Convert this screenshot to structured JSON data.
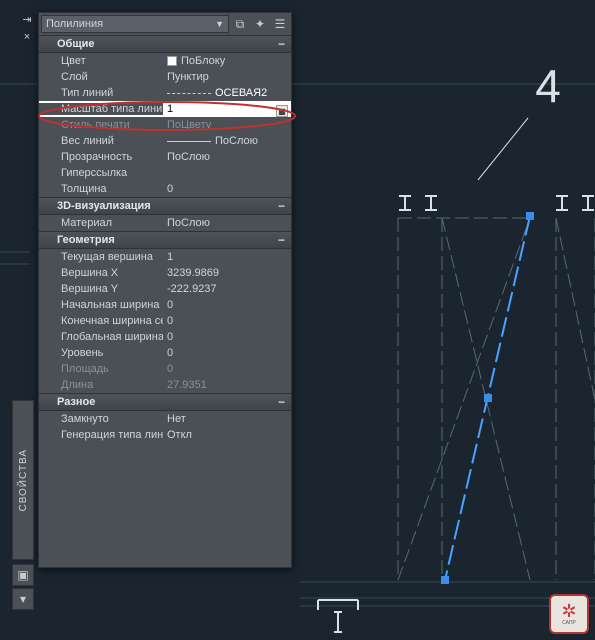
{
  "selector": {
    "value": "Полилиния"
  },
  "sections": {
    "general": {
      "title": "Общие"
    },
    "viz3d": {
      "title": "3D-визуализация"
    },
    "geometry": {
      "title": "Геометрия"
    },
    "misc": {
      "title": "Разное"
    }
  },
  "props": {
    "color": {
      "label": "Цвет",
      "value": "ПоБлоку"
    },
    "layer": {
      "label": "Слой",
      "value": "Пунктир"
    },
    "linetype": {
      "label": "Тип линий",
      "value": "ОСЕВАЯ2"
    },
    "ltscale": {
      "label": "Масштаб типа линий",
      "value": "1"
    },
    "plotstyle": {
      "label": "Стиль печати",
      "value": "ПоЦвету"
    },
    "lweight": {
      "label": "Вес линий",
      "value": "ПоСлою"
    },
    "transp": {
      "label": "Прозрачность",
      "value": "ПоСлою"
    },
    "hyper": {
      "label": "Гиперссылка",
      "value": ""
    },
    "thick": {
      "label": "Толщина",
      "value": "0"
    },
    "material": {
      "label": "Материал",
      "value": "ПоСлою"
    },
    "curvtx": {
      "label": "Текущая вершина",
      "value": "1"
    },
    "vx": {
      "label": "Вершина X",
      "value": "3239.9869"
    },
    "vy": {
      "label": "Вершина Y",
      "value": "-222.9237"
    },
    "startw": {
      "label": "Начальная ширина с...",
      "value": "0"
    },
    "endw": {
      "label": "Конечная ширина се...",
      "value": "0"
    },
    "globalw": {
      "label": "Глобальная ширина",
      "value": "0"
    },
    "elev": {
      "label": "Уровень",
      "value": "0"
    },
    "area": {
      "label": "Площадь",
      "value": "0"
    },
    "length": {
      "label": "Длина",
      "value": "27.9351"
    },
    "closed": {
      "label": "Замкнуто",
      "value": "Нет"
    },
    "ltgen": {
      "label": "Генерация типа линий",
      "value": "Откл"
    }
  },
  "vtab": {
    "label": "СВОЙСТВА"
  },
  "drawing": {
    "axis_label": "4",
    "logo_text": "САПР"
  }
}
